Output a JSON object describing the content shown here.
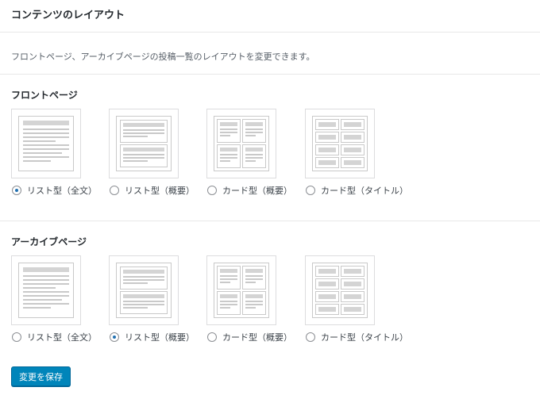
{
  "page": {
    "title": "コンテンツのレイアウト",
    "description": "フロントページ、アーカイブページの投稿一覧のレイアウトを変更できます。"
  },
  "sections": [
    {
      "title": "フロントページ",
      "selected": 0,
      "options": [
        {
          "label": "リスト型（全文）",
          "layout": "full-list"
        },
        {
          "label": "リスト型（概要）",
          "layout": "summary-list"
        },
        {
          "label": "カード型（概要）",
          "layout": "summary-card"
        },
        {
          "label": "カード型（タイトル）",
          "layout": "title-card"
        }
      ]
    },
    {
      "title": "アーカイブページ",
      "selected": 1,
      "options": [
        {
          "label": "リスト型（全文）",
          "layout": "full-list"
        },
        {
          "label": "リスト型（概要）",
          "layout": "summary-list"
        },
        {
          "label": "カード型（概要）",
          "layout": "summary-card"
        },
        {
          "label": "カード型（タイトル）",
          "layout": "title-card"
        }
      ]
    }
  ],
  "save_button": {
    "label": "変更を保存"
  },
  "colors": {
    "primary_button": "#0085ba",
    "radio_checked": "#2271b1"
  }
}
